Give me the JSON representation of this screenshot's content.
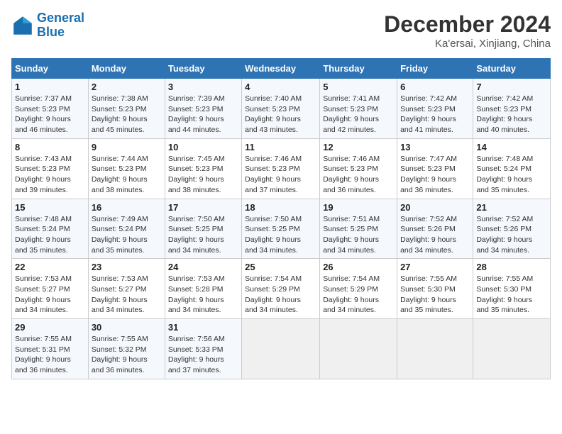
{
  "logo": {
    "line1": "General",
    "line2": "Blue"
  },
  "title": "December 2024",
  "subtitle": "Ka'ersai, Xinjiang, China",
  "days_of_week": [
    "Sunday",
    "Monday",
    "Tuesday",
    "Wednesday",
    "Thursday",
    "Friday",
    "Saturday"
  ],
  "weeks": [
    [
      {
        "day": 1,
        "info": "Sunrise: 7:37 AM\nSunset: 5:23 PM\nDaylight: 9 hours\nand 46 minutes."
      },
      {
        "day": 2,
        "info": "Sunrise: 7:38 AM\nSunset: 5:23 PM\nDaylight: 9 hours\nand 45 minutes."
      },
      {
        "day": 3,
        "info": "Sunrise: 7:39 AM\nSunset: 5:23 PM\nDaylight: 9 hours\nand 44 minutes."
      },
      {
        "day": 4,
        "info": "Sunrise: 7:40 AM\nSunset: 5:23 PM\nDaylight: 9 hours\nand 43 minutes."
      },
      {
        "day": 5,
        "info": "Sunrise: 7:41 AM\nSunset: 5:23 PM\nDaylight: 9 hours\nand 42 minutes."
      },
      {
        "day": 6,
        "info": "Sunrise: 7:42 AM\nSunset: 5:23 PM\nDaylight: 9 hours\nand 41 minutes."
      },
      {
        "day": 7,
        "info": "Sunrise: 7:42 AM\nSunset: 5:23 PM\nDaylight: 9 hours\nand 40 minutes."
      }
    ],
    [
      {
        "day": 8,
        "info": "Sunrise: 7:43 AM\nSunset: 5:23 PM\nDaylight: 9 hours\nand 39 minutes."
      },
      {
        "day": 9,
        "info": "Sunrise: 7:44 AM\nSunset: 5:23 PM\nDaylight: 9 hours\nand 38 minutes."
      },
      {
        "day": 10,
        "info": "Sunrise: 7:45 AM\nSunset: 5:23 PM\nDaylight: 9 hours\nand 38 minutes."
      },
      {
        "day": 11,
        "info": "Sunrise: 7:46 AM\nSunset: 5:23 PM\nDaylight: 9 hours\nand 37 minutes."
      },
      {
        "day": 12,
        "info": "Sunrise: 7:46 AM\nSunset: 5:23 PM\nDaylight: 9 hours\nand 36 minutes."
      },
      {
        "day": 13,
        "info": "Sunrise: 7:47 AM\nSunset: 5:23 PM\nDaylight: 9 hours\nand 36 minutes."
      },
      {
        "day": 14,
        "info": "Sunrise: 7:48 AM\nSunset: 5:24 PM\nDaylight: 9 hours\nand 35 minutes."
      }
    ],
    [
      {
        "day": 15,
        "info": "Sunrise: 7:48 AM\nSunset: 5:24 PM\nDaylight: 9 hours\nand 35 minutes."
      },
      {
        "day": 16,
        "info": "Sunrise: 7:49 AM\nSunset: 5:24 PM\nDaylight: 9 hours\nand 35 minutes."
      },
      {
        "day": 17,
        "info": "Sunrise: 7:50 AM\nSunset: 5:25 PM\nDaylight: 9 hours\nand 34 minutes."
      },
      {
        "day": 18,
        "info": "Sunrise: 7:50 AM\nSunset: 5:25 PM\nDaylight: 9 hours\nand 34 minutes."
      },
      {
        "day": 19,
        "info": "Sunrise: 7:51 AM\nSunset: 5:25 PM\nDaylight: 9 hours\nand 34 minutes."
      },
      {
        "day": 20,
        "info": "Sunrise: 7:52 AM\nSunset: 5:26 PM\nDaylight: 9 hours\nand 34 minutes."
      },
      {
        "day": 21,
        "info": "Sunrise: 7:52 AM\nSunset: 5:26 PM\nDaylight: 9 hours\nand 34 minutes."
      }
    ],
    [
      {
        "day": 22,
        "info": "Sunrise: 7:53 AM\nSunset: 5:27 PM\nDaylight: 9 hours\nand 34 minutes."
      },
      {
        "day": 23,
        "info": "Sunrise: 7:53 AM\nSunset: 5:27 PM\nDaylight: 9 hours\nand 34 minutes."
      },
      {
        "day": 24,
        "info": "Sunrise: 7:53 AM\nSunset: 5:28 PM\nDaylight: 9 hours\nand 34 minutes."
      },
      {
        "day": 25,
        "info": "Sunrise: 7:54 AM\nSunset: 5:29 PM\nDaylight: 9 hours\nand 34 minutes."
      },
      {
        "day": 26,
        "info": "Sunrise: 7:54 AM\nSunset: 5:29 PM\nDaylight: 9 hours\nand 34 minutes."
      },
      {
        "day": 27,
        "info": "Sunrise: 7:55 AM\nSunset: 5:30 PM\nDaylight: 9 hours\nand 35 minutes."
      },
      {
        "day": 28,
        "info": "Sunrise: 7:55 AM\nSunset: 5:30 PM\nDaylight: 9 hours\nand 35 minutes."
      }
    ],
    [
      {
        "day": 29,
        "info": "Sunrise: 7:55 AM\nSunset: 5:31 PM\nDaylight: 9 hours\nand 36 minutes."
      },
      {
        "day": 30,
        "info": "Sunrise: 7:55 AM\nSunset: 5:32 PM\nDaylight: 9 hours\nand 36 minutes."
      },
      {
        "day": 31,
        "info": "Sunrise: 7:56 AM\nSunset: 5:33 PM\nDaylight: 9 hours\nand 37 minutes."
      },
      {
        "day": null,
        "info": ""
      },
      {
        "day": null,
        "info": ""
      },
      {
        "day": null,
        "info": ""
      },
      {
        "day": null,
        "info": ""
      }
    ]
  ]
}
